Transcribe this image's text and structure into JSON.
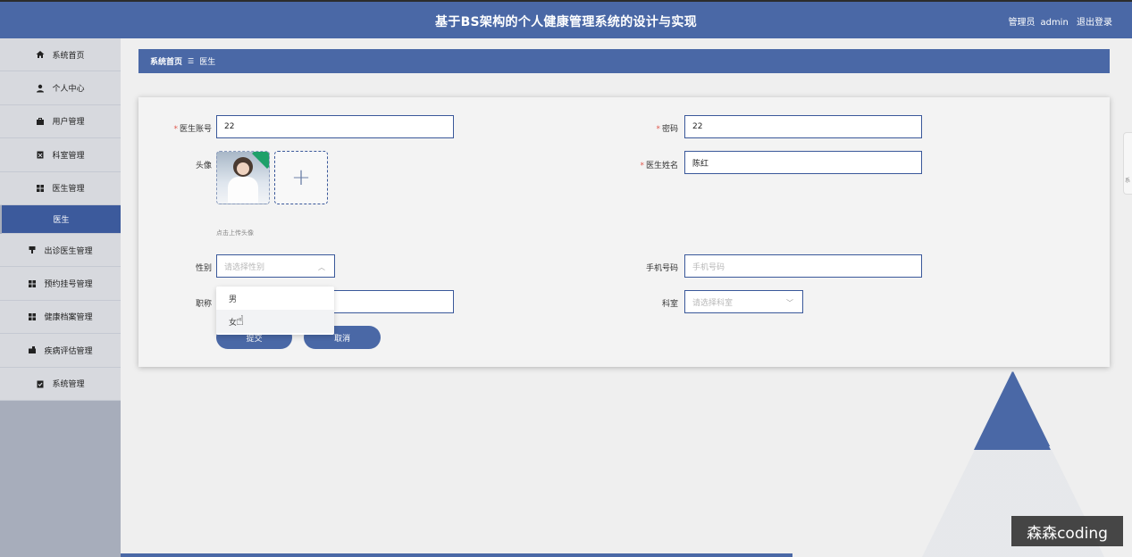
{
  "header": {
    "title": "基于BS架构的个人健康管理系统的设计与实现",
    "user_role": "管理员",
    "username": "admin",
    "logout": "退出登录"
  },
  "sidebar": {
    "items": [
      {
        "label": "系统首页",
        "icon": "home-icon"
      },
      {
        "label": "个人中心",
        "icon": "user-icon"
      },
      {
        "label": "用户管理",
        "icon": "briefcase-icon"
      },
      {
        "label": "科室管理",
        "icon": "clipboard-icon"
      },
      {
        "label": "医生管理",
        "icon": "grid-icon"
      },
      {
        "label": "出诊医生管理",
        "icon": "cup-icon"
      },
      {
        "label": "预约挂号管理",
        "icon": "grid-icon"
      },
      {
        "label": "健康档案管理",
        "icon": "grid-icon"
      },
      {
        "label": "疾病评估管理",
        "icon": "briefcase-icon"
      },
      {
        "label": "系统管理",
        "icon": "clipboard-check-icon"
      }
    ],
    "active_sub": "医生"
  },
  "breadcrumb": {
    "home": "系统首页",
    "separator": "☰",
    "current": "医生"
  },
  "form": {
    "account_label": "医生账号",
    "account_value": "22",
    "password_label": "密码",
    "password_value": "22",
    "avatar_label": "头像",
    "upload_hint": "点击上传头像",
    "name_label": "医生姓名",
    "name_value": "陈红",
    "gender_label": "性别",
    "gender_placeholder": "请选择性别",
    "phone_label": "手机号码",
    "phone_placeholder": "手机号码",
    "title_label": "职称",
    "dept_label": "科室",
    "dept_placeholder": "请选择科室",
    "gender_options": [
      "男",
      "女"
    ],
    "submit": "提交",
    "cancel": "取消"
  },
  "watermark": "森森coding",
  "right_tab": "系"
}
